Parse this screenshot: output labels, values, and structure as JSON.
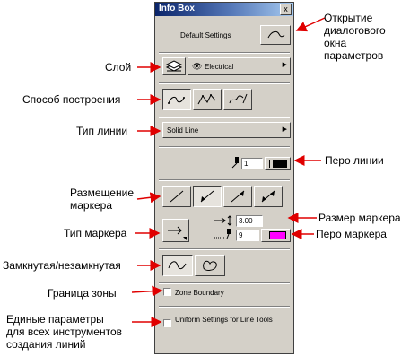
{
  "window": {
    "title": "Info Box",
    "close_glyph": "x"
  },
  "default_settings": {
    "label": "Default Settings"
  },
  "layer": {
    "value": "Electrical"
  },
  "line_type": {
    "value": "Solid Line"
  },
  "pen": {
    "value": "1",
    "color": "#000000"
  },
  "marker": {
    "size": "3.00",
    "pen_value": "9",
    "pen_color": "#ff00ff"
  },
  "zone_boundary": {
    "label": "Zone Boundary"
  },
  "uniform_settings": {
    "label": "Uniform Settings for Line Tools"
  },
  "annotations": {
    "open_dialog": [
      "Открытие",
      "диалогового",
      "окна",
      "параметров"
    ],
    "layer": "Слой",
    "construction": "Способ построения",
    "line_type": "Тип линии",
    "line_pen": "Перо линии",
    "marker_placement": [
      "Размещение",
      "маркера"
    ],
    "marker_size": "Размер маркера",
    "marker_type": "Тип маркера",
    "marker_pen": "Перо маркера",
    "closed_open": "Замкнутая/незамкнутая",
    "zone_boundary": "Граница зоны",
    "uniform": [
      "Единые параметры",
      "для всех инструментов",
      "создания линий"
    ]
  },
  "colors": {
    "panel": "#d4d0c8",
    "arrow": "#e00000",
    "title_start": "#0a246a"
  }
}
